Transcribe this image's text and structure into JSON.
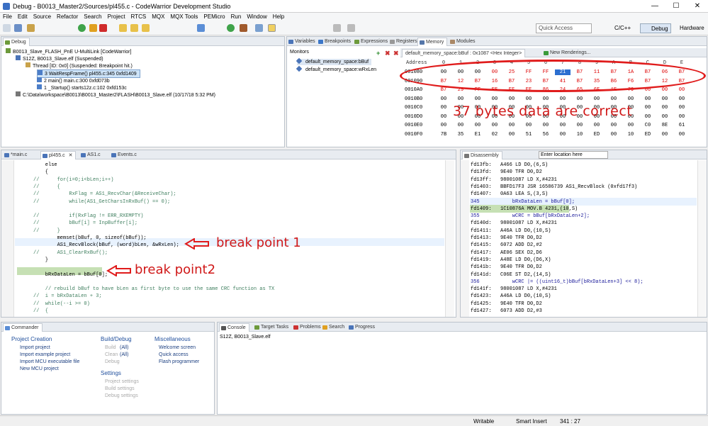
{
  "window": {
    "title": "Debug - B0013_Master2/Sources/pl455.c - CodeWarrior Development Studio",
    "min": "—",
    "max": "☐",
    "close": "✕"
  },
  "menu": [
    "File",
    "Edit",
    "Source",
    "Refactor",
    "Search",
    "Project",
    "RTCS",
    "MQX",
    "MQX Tools",
    "PEMicro",
    "Run",
    "Window",
    "Help"
  ],
  "toolbar": {
    "quick_access": "Quick Access",
    "perspectives": [
      "C/C++",
      "Debug",
      "Hardware"
    ]
  },
  "debug_view": {
    "tabs": [
      "Debug",
      "Variables",
      "Breakpoints",
      "Expressions",
      "Registers",
      "Memory",
      "Modules"
    ],
    "tree": [
      "B0013_Slave_FLASH_PnE U-MultiLink [CodeWarrior]",
      "S12Z, B0013_Slave.elf (Suspended)",
      "Thread [ID: 0x0] (Suspended: Breakpoint hit.)",
      "3 WaitRespFrame() pl455.c:345 0xfd1409",
      "2 main() main.c:300 0xfd073b",
      "1 _Startup() starts12z.c:102 0xfd153c",
      "C:\\Data\\workspace\\B0013\\B0013_Master2\\FLASH\\B0013_Slave.elf (10/17/18 5:32 PM)"
    ]
  },
  "memory": {
    "monitors_label": "Monitors",
    "monitors": [
      "default_memory_space:bBuf",
      "default_memory_space:wRxLen"
    ],
    "rendering_tab": "default_memory_space:bBuf : 0x1087 <Hex Integer>",
    "new_renderings": "New Renderings...",
    "header": [
      "Address",
      "0",
      "1",
      "2",
      "3",
      "4",
      "5",
      "6",
      "7",
      "8",
      "9",
      "A",
      "B",
      "C",
      "D",
      "E"
    ],
    "rows": [
      [
        "001080",
        "00",
        "00",
        "00",
        "00",
        "25",
        "FF",
        "FF",
        "21",
        "B7",
        "11",
        "B7",
        "1A",
        "B7",
        "06",
        "B7"
      ],
      [
        "001090",
        "B7",
        "12",
        "B7",
        "16",
        "B7",
        "23",
        "B7",
        "41",
        "B7",
        "35",
        "B6",
        "F6",
        "B7",
        "12",
        "B7"
      ],
      [
        "0010A0",
        "B7",
        "29",
        "FF",
        "EE",
        "FF",
        "EE",
        "86",
        "24",
        "65",
        "6E",
        "1E",
        "79",
        "00",
        "00",
        "00"
      ],
      [
        "0010B0",
        "00",
        "00",
        "00",
        "00",
        "00",
        "00",
        "00",
        "00",
        "00",
        "00",
        "00",
        "00",
        "00",
        "00",
        "00"
      ],
      [
        "0010C0",
        "00",
        "00",
        "00",
        "00",
        "00",
        "00",
        "00",
        "00",
        "00",
        "00",
        "00",
        "00",
        "00",
        "00",
        "00"
      ],
      [
        "0010D0",
        "00",
        "00",
        "00",
        "00",
        "00",
        "00",
        "00",
        "00",
        "00",
        "00",
        "00",
        "00",
        "00",
        "00",
        "00"
      ],
      [
        "0010E0",
        "00",
        "00",
        "00",
        "00",
        "00",
        "00",
        "00",
        "00",
        "00",
        "00",
        "00",
        "00",
        "C0",
        "8E",
        "61"
      ],
      [
        "0010F0",
        "7B",
        "35",
        "E1",
        "02",
        "00",
        "51",
        "56",
        "00",
        "10",
        "ED",
        "00",
        "10",
        "ED",
        "00",
        "00"
      ]
    ],
    "annotation": "37 bytes data are correct"
  },
  "editor": {
    "tabs": [
      "*main.c",
      "pl455.c",
      "AS1.c",
      "Events.c"
    ],
    "lines": [
      "    else",
      "    {",
      "//      for(i=0;i<bLen;i++)",
      "//      {",
      "//          RxFlag = AS1_RecvChar(&ReceiveChar);",
      "//          while(AS1_GetCharsInRxBuf() == 0);",
      "",
      "//          if(RxFlag != ERR_RXEMPTY)",
      "//          bBuf[i] = InpBuffer[i];",
      "//      }",
      "        memset(bBuf, 0, sizeof(bBuf));",
      "        AS1_RecvBlock(bBuf, (word)bLen, &wRxLen);",
      "//      AS1_ClearRxBuf();",
      "    }",
      "",
      "    bRxDataLen = bBuf[0];",
      "",
      "    // rebuild bBuf to have bLen as first byte to use the same CRC function as TX",
      "//  i = bRxDataLen + 3;",
      "//  while(--i >= 0)",
      "//  {"
    ],
    "annotation_bp1": "break point 1",
    "annotation_bp2": "break point2"
  },
  "disassembly": {
    "tab": "Disassembly",
    "location_placeholder": "Enter location here",
    "lines": [
      "fd13fb:   A466 LD D0,(6,S)",
      "fd13fd:   9E40 TFR D0,D2",
      "fd13ff:   98001087 LD X,#4231",
      "fd1403:   BBFD17F3 JSR 16586739 AS1_RecvBlock (0xfd17f3)",
      "fd1407:   0A63 LEA S,(3,S)",
      "345           bRxDataLen = bBuf[0];",
      "fd1409:   1C10876A MOV.B 4231,(10,S)",
      "355           wCRC = bBuf[bRxDataLen+2];",
      "fd140d:   98001087 LD X,#4231",
      "fd1411:   A46A LD D0,(10,S)",
      "fd1413:   9E40 TFR D0,D2",
      "fd1415:   6072 ADD D2,#2",
      "fd1417:   AE06 SEX D2,D6",
      "fd1419:   A48E LD D0,(D6,X)",
      "fd141b:   9E40 TFR D0,D2",
      "fd141d:   C06E ST D2,(14,S)",
      "356           wCRC |= ((uint16_t)bBuf[bRxDataLen+3] << 8);",
      "fd141f:   98001087 LD X,#4231",
      "fd1423:   A46A LD D0,(10,S)",
      "fd1425:   9E40 TFR D0,D2",
      "fd1427:   6073 ADD D2,#3"
    ]
  },
  "commander": {
    "tab": "Commander",
    "project_creation": {
      "title": "Project Creation",
      "items": [
        "Import project",
        "Import example project",
        "Import MCU executable file",
        "New MCU project"
      ]
    },
    "build_debug": {
      "title": "Build/Debug",
      "items": [
        [
          "Build",
          "(All)"
        ],
        [
          "Clean",
          "(All)"
        ],
        [
          "Debug",
          ""
        ]
      ]
    },
    "settings": {
      "title": "Settings",
      "items": [
        "Project settings",
        "Build settings",
        "Debug settings"
      ]
    },
    "misc": {
      "title": "Miscellaneous",
      "items": [
        "Welcome screen",
        "Quick access",
        "Flash programmer"
      ]
    }
  },
  "console": {
    "tabs": [
      "Console",
      "Target Tasks",
      "Problems",
      "Search",
      "Progress"
    ],
    "content": "S12Z, B0013_Slave.elf"
  },
  "status": {
    "mode": "Writable",
    "insert": "Smart Insert",
    "pos": "341 : 27"
  }
}
